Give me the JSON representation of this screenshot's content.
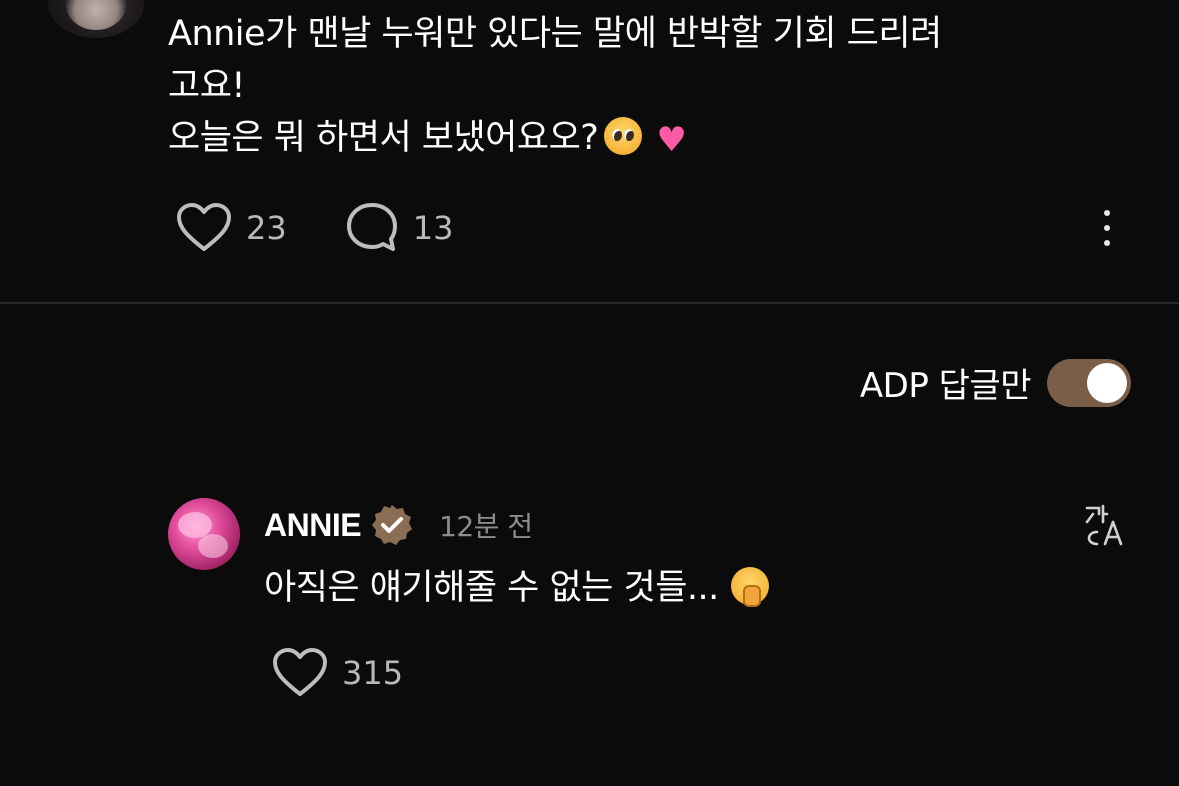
{
  "post": {
    "lines": [
      "Annie가 맨날 누워만 있다는 말에 반박할 기회 드리려",
      "고요!",
      "오늘은 뭐 하면서 보냈어요오?"
    ],
    "emojis": [
      "pleading-face",
      "growing-heart"
    ],
    "likes": "23",
    "comments": "13"
  },
  "filter": {
    "label": "ADP 답글만",
    "enabled": true,
    "accent_color": "#7a5e48"
  },
  "reply": {
    "author": "ANNIE",
    "verified": true,
    "time": "12분 전",
    "text": "아직은 얘기해줄 수 없는 것들...",
    "emoji": "shushing-face",
    "likes": "315"
  },
  "icons": {
    "like": "heart-outline-icon",
    "comment": "speech-bubble-icon",
    "more": "vertical-ellipsis-icon",
    "translate": "translate-icon",
    "verified": "verified-badge-icon"
  }
}
